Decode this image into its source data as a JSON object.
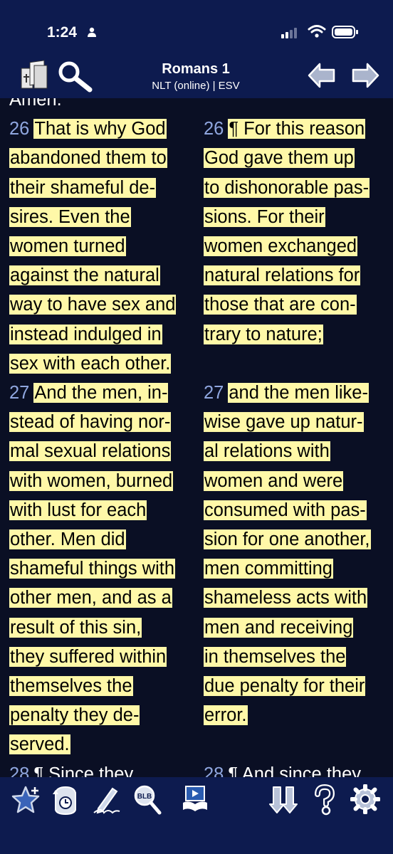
{
  "status_bar": {
    "time": "1:24"
  },
  "header": {
    "title": "Romans 1",
    "subtitle": "NLT (online) | ESV"
  },
  "left_column": {
    "lines": [
      {
        "text": "Amen.",
        "plain": true
      },
      {
        "vnum": "26",
        "text": "That is why God"
      },
      {
        "text": "abandoned them to"
      },
      {
        "text": "their shameful de-"
      },
      {
        "text": "sires. Even the"
      },
      {
        "text": "women turned"
      },
      {
        "text": "against the natural"
      },
      {
        "text": "way to have sex and"
      },
      {
        "text": "instead indulged in"
      },
      {
        "text": "sex with each other."
      },
      {
        "vnum": "27",
        "text": "And the men, in-"
      },
      {
        "text": "stead of having nor-"
      },
      {
        "text": "mal sexual relations"
      },
      {
        "text": "with women, burned"
      },
      {
        "text": "with lust for each"
      },
      {
        "text": "other. Men did"
      },
      {
        "text": "shameful things with"
      },
      {
        "text": "other men, and as a"
      },
      {
        "text": "result of this sin,"
      },
      {
        "text": "they suffered within"
      },
      {
        "text": "themselves the"
      },
      {
        "text": "penalty they de-"
      },
      {
        "text": "served."
      },
      {
        "vnum": "28",
        "text": "¶ Since they",
        "plain": true
      }
    ]
  },
  "right_column": {
    "lines": [
      {
        "text": "",
        "plain": true
      },
      {
        "vnum": "26",
        "text": "¶ For this reason"
      },
      {
        "text": "God gave them up"
      },
      {
        "text": "to dishonorable pas-"
      },
      {
        "text": "sions. For their"
      },
      {
        "text": "women exchanged"
      },
      {
        "text": "natural relations for"
      },
      {
        "text": "those that are con-"
      },
      {
        "text": "trary to nature;"
      },
      {
        "text": "",
        "plain": true
      },
      {
        "vnum": "27",
        "text": "and the men like-"
      },
      {
        "text": "wise gave up natur-"
      },
      {
        "text": "al relations with"
      },
      {
        "text": "women and were"
      },
      {
        "text": "consumed with pas-"
      },
      {
        "text": "sion for one another,"
      },
      {
        "text": "men committing"
      },
      {
        "text": "shameless acts with"
      },
      {
        "text": "men and receiving"
      },
      {
        "text": "in themselves the"
      },
      {
        "text": "due penalty for their"
      },
      {
        "text": "error."
      },
      {
        "text": "",
        "plain": true
      },
      {
        "vnum": "28",
        "text": "¶ And since they",
        "plain": true
      }
    ]
  },
  "toolbar": {
    "icons": [
      "favorites-star-icon",
      "history-clock-icon",
      "notes-pen-icon",
      "blb-search-icon",
      "reading-plan-icon",
      "parallel-columns-icon",
      "help-icon",
      "settings-gear-icon"
    ],
    "blb_label": "BLB"
  },
  "colors": {
    "header_bg": "#0d1b4f",
    "content_bg": "#0a0f24",
    "highlight": "#fff8a8",
    "verse_number": "#8fa6df"
  }
}
